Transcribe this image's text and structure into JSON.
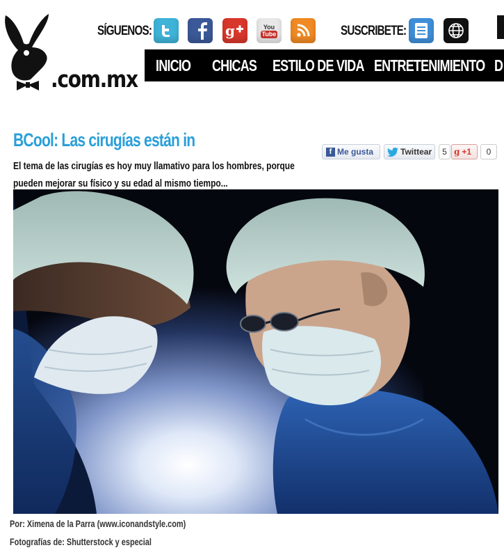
{
  "header": {
    "logo_text": ".com.mx",
    "follow_label": "SÍGUENOS:",
    "subscribe_label": "SUSCRIBETE:",
    "social_icons": [
      "twitter-icon",
      "facebook-icon",
      "google-plus-icon",
      "youtube-icon",
      "rss-icon"
    ],
    "subscribe_icons": [
      "newsletter-icon",
      "web-icon"
    ],
    "youtube_top": "You",
    "youtube_bottom": "Tube"
  },
  "nav": {
    "items": [
      "INICIO",
      "CHICAS",
      "ESTILO DE VIDA",
      "ENTRETENIMIENTO",
      "D"
    ]
  },
  "article": {
    "title": "BCool: Las cirugías están in",
    "summary": "El tema de las cirugías es hoy muy llamativo para los hombres, porque pueden mejorar su físico y su edad al mismo tiempo...",
    "author": "Por: Ximena de la Parra (www.iconandstyle.com)",
    "photo_credit": "Fotografías de: Shutterstock y especial"
  },
  "share": {
    "like_label": "Me gusta",
    "tweet_label": "Twittear",
    "tweet_count": "5",
    "gplus_label": "+1",
    "gplus_count": "0"
  },
  "colors": {
    "title": "#2a9fd8",
    "nav_bg": "#000000",
    "twitter": "#3fb3d8",
    "facebook": "#3b5998",
    "google_plus": "#d8372b",
    "youtube": "#e8e8e8",
    "rss": "#f08a24"
  }
}
